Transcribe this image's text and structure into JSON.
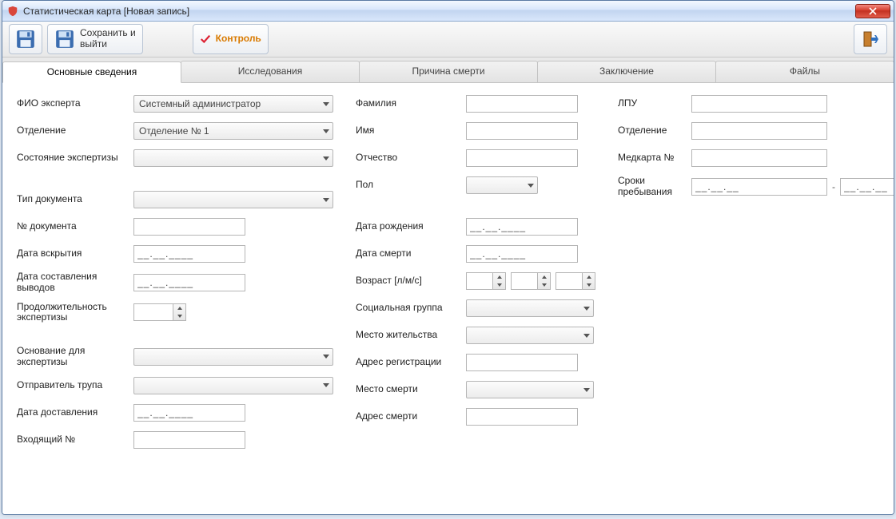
{
  "window": {
    "title": "Статистическая карта [Новая запись]"
  },
  "toolbar": {
    "save_label": "",
    "save_exit_label": "Сохранить и\nвыйти",
    "control_label": "Контроль"
  },
  "tabs": [
    {
      "label": "Основные сведения",
      "active": true
    },
    {
      "label": "Исследования"
    },
    {
      "label": "Причина смерти"
    },
    {
      "label": "Заключение"
    },
    {
      "label": "Файлы"
    }
  ],
  "col1": {
    "expert_fio": {
      "label": "ФИО эксперта",
      "value": "Системный администратор"
    },
    "department": {
      "label": "Отделение",
      "value": "Отделение № 1"
    },
    "exam_state": {
      "label": "Состояние экспертизы",
      "value": ""
    },
    "doc_type": {
      "label": "Тип документа",
      "value": ""
    },
    "doc_no": {
      "label": "№ документа",
      "value": ""
    },
    "open_date": {
      "label": "Дата вскрытия",
      "value": "__.__.____"
    },
    "conclusions_date": {
      "label": "Дата составления выводов",
      "value": "__.__.____"
    },
    "duration": {
      "label": "Продолжительность экспертизы",
      "value": ""
    },
    "basis": {
      "label": "Основание для экспертизы",
      "value": ""
    },
    "sender": {
      "label": "Отправитель трупа",
      "value": ""
    },
    "delivery_date": {
      "label": "Дата доставления",
      "value": "__.__.____"
    },
    "incoming_no": {
      "label": "Входящий №",
      "value": ""
    }
  },
  "col2": {
    "surname": {
      "label": "Фамилия",
      "value": ""
    },
    "name": {
      "label": "Имя",
      "value": ""
    },
    "patronymic": {
      "label": "Отчество",
      "value": ""
    },
    "gender": {
      "label": "Пол",
      "value": ""
    },
    "birth": {
      "label": "Дата рождения",
      "value": "__.__.____"
    },
    "death": {
      "label": "Дата смерти",
      "value": "__.__.____"
    },
    "age": {
      "label": "Возраст [л/м/с]",
      "y": "",
      "m": "",
      "d": ""
    },
    "social": {
      "label": "Социальная группа",
      "value": ""
    },
    "residence": {
      "label": "Место жительства",
      "value": ""
    },
    "reg_addr": {
      "label": "Адрес регистрации",
      "value": ""
    },
    "death_place": {
      "label": "Место смерти",
      "value": ""
    },
    "death_addr": {
      "label": "Адрес смерти",
      "value": ""
    }
  },
  "col3": {
    "lpu": {
      "label": "ЛПУ",
      "value": ""
    },
    "department": {
      "label": "Отделение",
      "value": ""
    },
    "medcard": {
      "label": "Медкарта №",
      "value": ""
    },
    "stay": {
      "label": "Сроки пребывания",
      "from": "__.__.__",
      "to": "__.__.__",
      "dash": "-"
    }
  }
}
